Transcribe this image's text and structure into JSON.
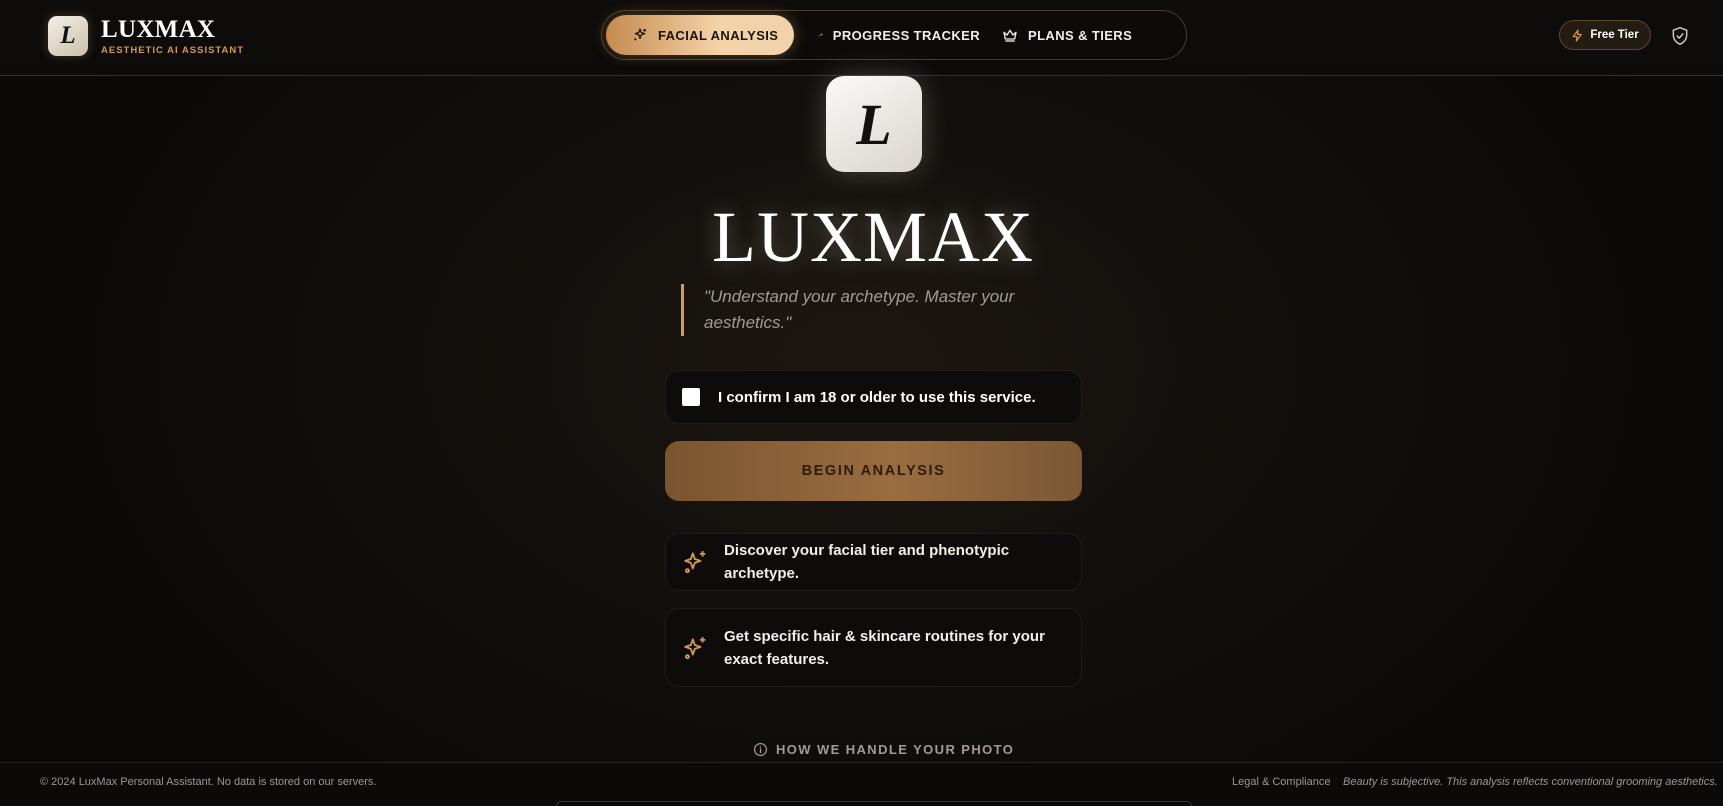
{
  "brand": {
    "logo_letter": "L",
    "name": "LUXMAX",
    "subtitle": "AESTHETIC AI ASSISTANT"
  },
  "nav": {
    "tabs": [
      {
        "label": "FACIAL ANALYSIS",
        "icon": "sparkles-icon",
        "active": true
      },
      {
        "label": "PROGRESS TRACKER",
        "icon": "trending-up-icon",
        "active": false
      },
      {
        "label": "PLANS & TIERS",
        "icon": "crown-icon",
        "active": false
      }
    ]
  },
  "header_right": {
    "tier_label": "Free Tier",
    "tier_icon": "lightning-icon",
    "shield_icon": "shield-check-icon"
  },
  "hero": {
    "logo_letter": "L",
    "title": "LUXMAX",
    "quote": "\"Understand your archetype. Master your aesthetics.\""
  },
  "confirm": {
    "label": "I confirm I am 18 or older to use this service.",
    "checked": false
  },
  "cta": {
    "label": "BEGIN ANALYSIS"
  },
  "features": [
    {
      "icon": "sparkles-icon",
      "text": "Discover your facial tier and phenotypic archetype."
    },
    {
      "icon": "sparkles-icon",
      "text": "Get specific hair & skincare routines for your exact features."
    }
  ],
  "photo_info": {
    "icon": "info-icon",
    "label": "HOW WE HANDLE YOUR PHOTO"
  },
  "footer": {
    "copyright": "© 2024 LuxMax Personal Assistant. No data is stored on our servers.",
    "legal_link": "Legal & Compliance",
    "disclaimer": "Beauty is subjective. This analysis reflects conventional grooming aesthetics."
  },
  "colors": {
    "accent": "#d39a55",
    "active_tab_start": "#c58b4f",
    "active_tab_end": "#f0d2ab",
    "cta_bg": "#9a6d3f",
    "background": "#0b0a09"
  }
}
